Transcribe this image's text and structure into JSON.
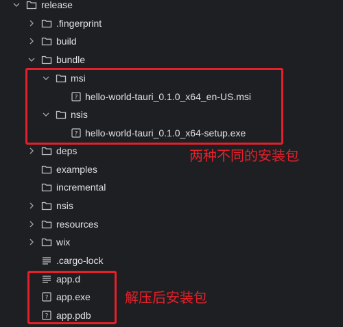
{
  "tree": {
    "release": "release",
    "fingerprint": ".fingerprint",
    "build": "build",
    "bundle": "bundle",
    "msi": "msi",
    "msi_file": "hello-world-tauri_0.1.0_x64_en-US.msi",
    "nsis_bundle": "nsis",
    "nsis_file": "hello-world-tauri_0.1.0_x64-setup.exe",
    "deps": "deps",
    "examples": "examples",
    "incremental": "incremental",
    "nsis": "nsis",
    "resources": "resources",
    "wix": "wix",
    "cargo_lock": ".cargo-lock",
    "app_d": "app.d",
    "app_exe": "app.exe",
    "app_pdb": "app.pdb"
  },
  "annotations": {
    "installers_note": "两种不同的安装包",
    "extracted_note": "解压后安装包",
    "color": "#e5202a"
  },
  "icons": {
    "folder": "folder-icon",
    "unknown_file": "unknown-file-icon",
    "text_file": "text-file-icon",
    "expanded": "chevron-down-icon",
    "collapsed": "chevron-right-icon"
  }
}
